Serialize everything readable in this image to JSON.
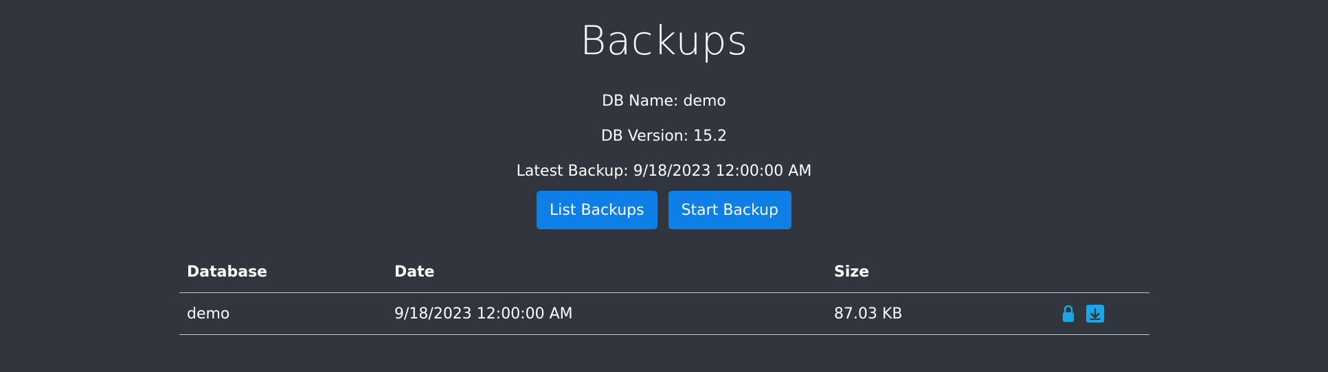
{
  "header": {
    "title": "Backups"
  },
  "info": {
    "db_name": "DB Name: demo",
    "db_version": "DB Version: 15.2",
    "latest_backup": "Latest Backup: 9/18/2023 12:00:00 AM"
  },
  "buttons": {
    "list_backups": "List Backups",
    "start_backup": "Start Backup"
  },
  "table": {
    "columns": [
      "Database",
      "Date",
      "Size",
      ""
    ],
    "rows": [
      {
        "database": "demo",
        "date": "9/18/2023 12:00:00 AM",
        "size": "87.03 KB",
        "actions": [
          "lock-icon",
          "download-icon"
        ]
      }
    ]
  },
  "colors": {
    "background": "#31353e",
    "primary": "#0d7fe6",
    "icon_accent": "#1aa6e8"
  }
}
